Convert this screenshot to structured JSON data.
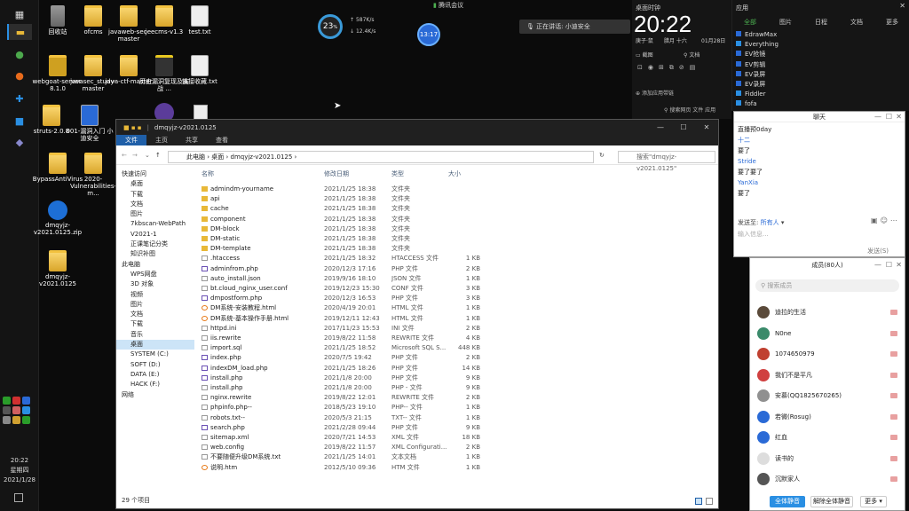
{
  "taskbar": {
    "clock_time": "20:22",
    "clock_weekday": "星期四",
    "clock_date": "2021/1/28"
  },
  "desktop": {
    "icons": [
      {
        "label": "回收站"
      },
      {
        "label": "ofcms"
      },
      {
        "label": "javaweb-sec-master"
      },
      {
        "label": "jeecms-v1.3"
      },
      {
        "label": "test.txt"
      },
      {
        "label": "webgoat-server-8.1.0"
      },
      {
        "label": "javasec_study-master"
      },
      {
        "label": "java-ctf-master"
      },
      {
        "label": "历史漏洞复现及实战 ..."
      },
      {
        "label": "链接收藏.txt"
      },
      {
        "label": "struts-2.0.8"
      },
      {
        "label": "001-漏洞入门 小迪安全"
      },
      {
        "label": "BypassAntiVirus"
      },
      {
        "label": "2020-Vulnerabilities-m..."
      },
      {
        "label": "dmqyjz-v2021.0125.zip"
      },
      {
        "label": "dmqyjz-v2021.0125"
      }
    ]
  },
  "hud": {
    "percent": "23",
    "net_up": "587",
    "net_up_unit": "K/s",
    "net_down": "12.4",
    "net_down_unit": "K/s",
    "meeting_label": "腾讯会议",
    "timer": "13:17",
    "speaking": "正在讲话: 小迪安全"
  },
  "explorer": {
    "title": "dmqyjz-v2021.0125",
    "ribbon_tabs": [
      "文件",
      "主页",
      "共享",
      "查看"
    ],
    "breadcrumb": [
      "此电脑",
      "桌面",
      "dmqyjz-v2021.0125"
    ],
    "search_placeholder": "搜索\"dmqyjz-v2021.0125\"",
    "nav": [
      "快速访问",
      "桌面",
      "下载",
      "文档",
      "图片",
      "7kbscan-WebPath",
      "V2021-1",
      "正课笔记分类",
      "知识补图",
      "此电脑",
      "WPS网盘",
      "3D 对象",
      "视频",
      "图片",
      "文档",
      "下载",
      "音乐",
      "桌面",
      "SYSTEM (C:)",
      "SOFT (D:)",
      "DATA (E:)",
      "HACK (F:)",
      "网络"
    ],
    "columns": {
      "name": "名称",
      "date": "修改日期",
      "type": "类型",
      "size": "大小"
    },
    "files": [
      {
        "name": "admindm-yourname",
        "date": "2021/1/25 18:38",
        "type": "文件夹",
        "size": "",
        "icon": "dir"
      },
      {
        "name": "api",
        "date": "2021/1/25 18:38",
        "type": "文件夹",
        "size": "",
        "icon": "dir"
      },
      {
        "name": "cache",
        "date": "2021/1/25 18:38",
        "type": "文件夹",
        "size": "",
        "icon": "dir"
      },
      {
        "name": "component",
        "date": "2021/1/25 18:38",
        "type": "文件夹",
        "size": "",
        "icon": "dir"
      },
      {
        "name": "DM-block",
        "date": "2021/1/25 18:38",
        "type": "文件夹",
        "size": "",
        "icon": "dir"
      },
      {
        "name": "DM-static",
        "date": "2021/1/25 18:38",
        "type": "文件夹",
        "size": "",
        "icon": "dir"
      },
      {
        "name": "DM-template",
        "date": "2021/1/25 18:38",
        "type": "文件夹",
        "size": "",
        "icon": "dir"
      },
      {
        "name": ".htaccess",
        "date": "2021/1/25 18:32",
        "type": "HTACCESS 文件",
        "size": "1 KB",
        "icon": "doc"
      },
      {
        "name": "adminfrom.php",
        "date": "2020/12/3 17:16",
        "type": "PHP 文件",
        "size": "2 KB",
        "icon": "php"
      },
      {
        "name": "auto_install.json",
        "date": "2019/9/16 18:10",
        "type": "JSON 文件",
        "size": "1 KB",
        "icon": "doc"
      },
      {
        "name": "bt.cloud_nginx_user.conf",
        "date": "2019/12/23 15:30",
        "type": "CONF 文件",
        "size": "3 KB",
        "icon": "doc"
      },
      {
        "name": "dmpostform.php",
        "date": "2020/12/3 16:53",
        "type": "PHP 文件",
        "size": "3 KB",
        "icon": "php"
      },
      {
        "name": "DM系统-安装教程.html",
        "date": "2020/4/19 20:01",
        "type": "HTML 文件",
        "size": "1 KB",
        "icon": "htm"
      },
      {
        "name": "DM系统-基本操作手册.html",
        "date": "2019/12/11 12:43",
        "type": "HTML 文件",
        "size": "1 KB",
        "icon": "htm"
      },
      {
        "name": "httpd.ini",
        "date": "2017/11/23 15:53",
        "type": "INI 文件",
        "size": "2 KB",
        "icon": "doc"
      },
      {
        "name": "iis.rewrite",
        "date": "2019/8/22 11:58",
        "type": "REWRITE 文件",
        "size": "4 KB",
        "icon": "doc"
      },
      {
        "name": "import.sql",
        "date": "2021/1/25 18:52",
        "type": "Microsoft SQL S...",
        "size": "448 KB",
        "icon": "doc"
      },
      {
        "name": "index.php",
        "date": "2020/7/5 19:42",
        "type": "PHP 文件",
        "size": "2 KB",
        "icon": "php"
      },
      {
        "name": "indexDM_load.php",
        "date": "2021/1/25 18:26",
        "type": "PHP 文件",
        "size": "14 KB",
        "icon": "php"
      },
      {
        "name": "install.php",
        "date": "2021/1/8 20:00",
        "type": "PHP 文件",
        "size": "9 KB",
        "icon": "php"
      },
      {
        "name": "install.php",
        "date": "2021/1/8 20:00",
        "type": "PHP - 文件",
        "size": "9 KB",
        "icon": "doc"
      },
      {
        "name": "nginx.rewrite",
        "date": "2019/8/22 12:01",
        "type": "REWRITE 文件",
        "size": "2 KB",
        "icon": "doc"
      },
      {
        "name": "phpinfo.php--",
        "date": "2018/5/23 19:10",
        "type": "PHP-- 文件",
        "size": "1 KB",
        "icon": "doc"
      },
      {
        "name": "robots.txt--",
        "date": "2020/5/3 21:15",
        "type": "TXT-- 文件",
        "size": "1 KB",
        "icon": "doc"
      },
      {
        "name": "search.php",
        "date": "2021/2/28 09:44",
        "type": "PHP 文件",
        "size": "9 KB",
        "icon": "php"
      },
      {
        "name": "sitemap.xml",
        "date": "2020/7/21 14:53",
        "type": "XML 文件",
        "size": "18 KB",
        "icon": "doc"
      },
      {
        "name": "web.config",
        "date": "2019/8/22 11:57",
        "type": "XML Configurati...",
        "size": "2 KB",
        "icon": "doc"
      },
      {
        "name": "不要随便升级DM系统.txt",
        "date": "2021/1/25 14:01",
        "type": "文本文档",
        "size": "1 KB",
        "icon": "doc"
      },
      {
        "name": "说明.htm",
        "date": "2012/5/10 09:36",
        "type": "HTM 文件",
        "size": "1 KB",
        "icon": "htm"
      }
    ],
    "status": "29 个项目"
  },
  "clock_widget": {
    "label": "桌面时钟",
    "time": "20:22",
    "lunar": "庚子·鼠",
    "lunar_day": "腊月 十六",
    "date": "01月28日",
    "tools": [
      "截图",
      "文档"
    ],
    "add_link": "添加应用带链",
    "search": "搜索网页 文件 应用"
  },
  "notes_panel": {
    "title": "应用",
    "tabs": [
      "全部",
      "图片",
      "日程",
      "文档",
      "更多"
    ],
    "apps": [
      "EdrawMax",
      "Everything",
      "EV抢镜",
      "EV剪辑",
      "EV录屏",
      "EV录屏",
      "Fiddler",
      "fofa"
    ]
  },
  "chat": {
    "title": "聊天",
    "messages": [
      {
        "user": "",
        "text": "直播预0day"
      },
      {
        "user": "十二",
        "text": "要了"
      },
      {
        "user": "Stride",
        "text": "要了要了"
      },
      {
        "user": "YanXia",
        "text": "要了"
      }
    ],
    "send_to_label": "发送至:",
    "send_to_value": "所有人",
    "input_placeholder": "输入信息...",
    "send_button": "发送(S)"
  },
  "members": {
    "title": "成员(80人)",
    "search_placeholder": "搜索成员",
    "list": [
      {
        "name": "迪拉的生活",
        "color": "#5a4a3a"
      },
      {
        "name": "N0ne",
        "color": "#3a8a6a"
      },
      {
        "name": "1074650979",
        "color": "#c04030"
      },
      {
        "name": "我们不是平凡",
        "color": "#d04040"
      },
      {
        "name": "安慕(QQ1825670265)",
        "color": "#909090"
      },
      {
        "name": "若微(Rosug)",
        "color": "#2a6ad6"
      },
      {
        "name": "红血",
        "color": "#2a6ad6"
      },
      {
        "name": "读书的",
        "color": "#dddddd"
      },
      {
        "name": "沉默家人",
        "color": "#555555"
      }
    ],
    "mute_all": "全体静音",
    "unmute_all": "解除全体静音",
    "more": "更多"
  }
}
